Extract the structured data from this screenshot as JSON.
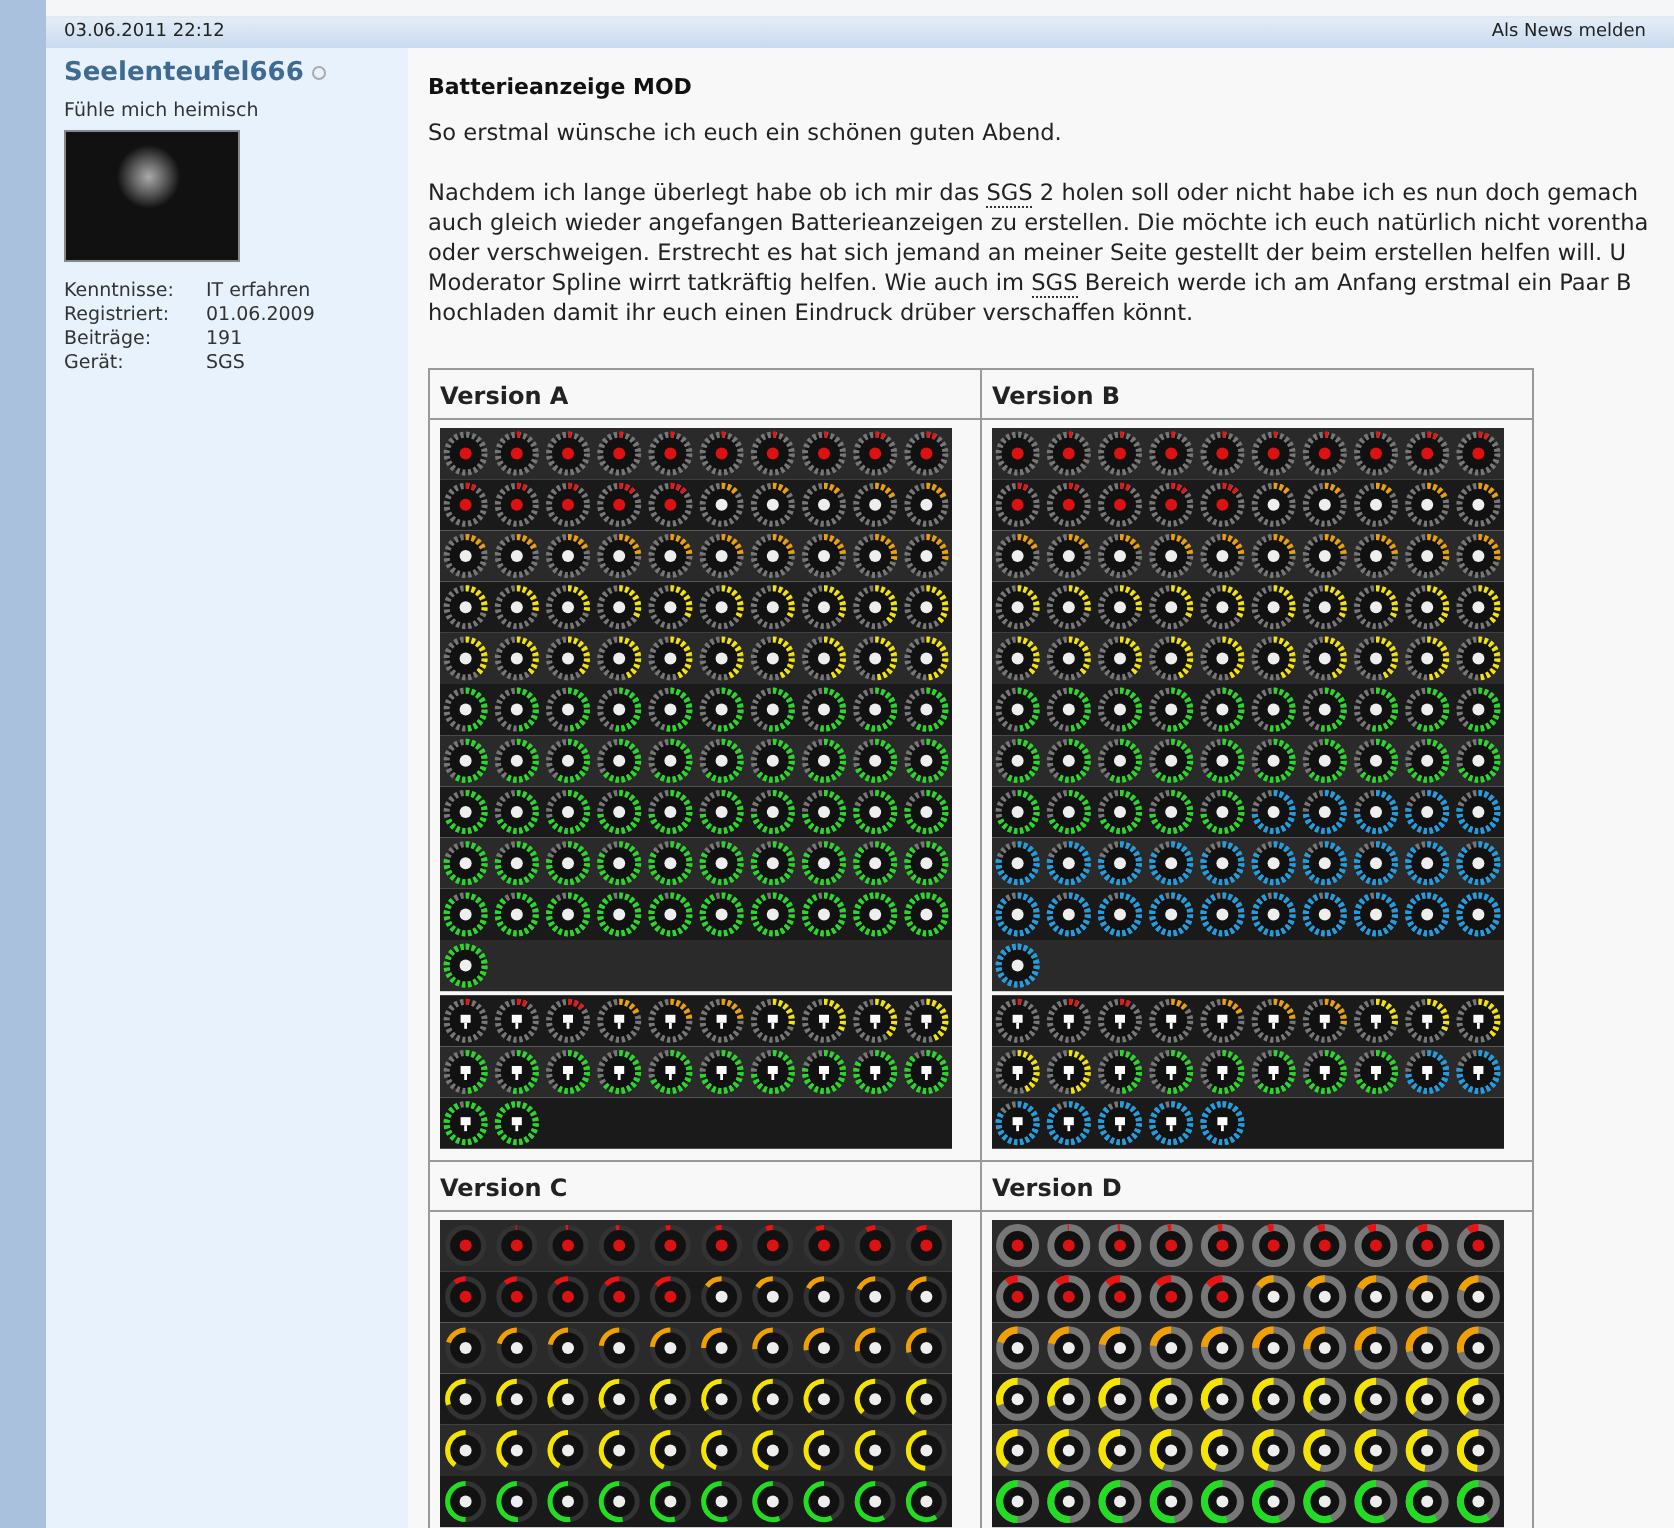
{
  "post": {
    "date": "03.06.2011 22:12",
    "report_link": "Als News melden"
  },
  "author": {
    "name": "Seelenteufel666",
    "online": false,
    "rank": "Fühle mich heimisch",
    "details": [
      {
        "label": "Kenntnisse:",
        "value": "IT erfahren"
      },
      {
        "label": "Registriert:",
        "value": "01.06.2009"
      },
      {
        "label": "Beiträge:",
        "value": "191"
      },
      {
        "label": "Gerät:",
        "value": "SGS"
      }
    ]
  },
  "title": "Batterieanzeige MOD",
  "greeting": "So erstmal wünsche ich euch ein schönen guten Abend.",
  "body_lines": [
    [
      {
        "text": "Nachdem ich lange überlegt habe ob ich mir das ",
        "abbr": false
      },
      {
        "text": "SGS",
        "abbr": true
      },
      {
        "text": " 2 holen soll oder nicht habe ich es nun doch gemach",
        "abbr": false
      }
    ],
    [
      {
        "text": "auch gleich wieder angefangen Batterieanzeigen zu erstellen. Die möchte ich euch natürlich nicht vorentha",
        "abbr": false
      }
    ],
    [
      {
        "text": "oder verschweigen. Erstrecht es hat sich jemand an meiner Seite gestellt der beim erstellen helfen will. U",
        "abbr": false
      }
    ],
    [
      {
        "text": "Moderator Spline wirrt tatkräftig helfen. Wie auch im ",
        "abbr": false
      },
      {
        "text": "SGS",
        "abbr": true
      },
      {
        "text": " Bereich werde ich am Anfang erstmal ein Paar B",
        "abbr": false
      }
    ],
    [
      {
        "text": "hochladen damit ihr euch einen Eindruck drüber verschaffen könnt.",
        "abbr": false
      }
    ]
  ],
  "versions": [
    {
      "title": "Version A",
      "kind": "dashed",
      "color": "#22dd22"
    },
    {
      "title": "Version B",
      "kind": "dashed",
      "color": "#1aa0e8"
    },
    {
      "title": "Version C",
      "kind": "glossy",
      "color": "#22dd22"
    },
    {
      "title": "Version D",
      "kind": "thick",
      "color": "#22dd22"
    }
  ]
}
